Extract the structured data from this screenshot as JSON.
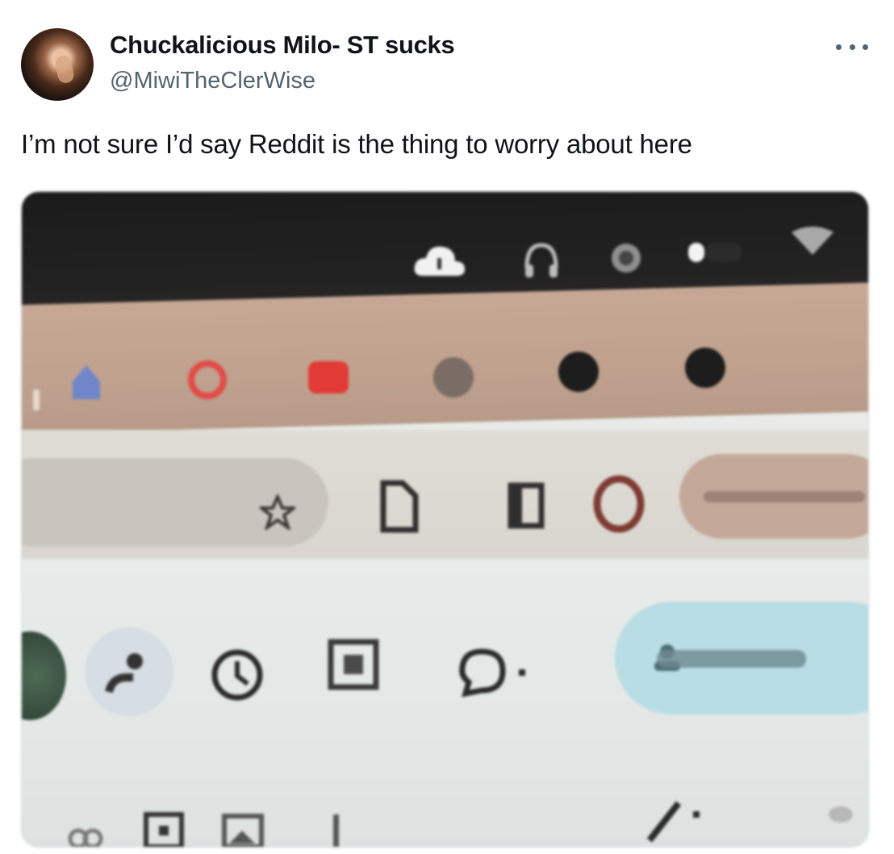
{
  "tweet": {
    "display_name": "Chuckalicious Milo- ST sucks",
    "handle": "@MiwiTheClerWise",
    "text": "I’m not sure I’d say Reddit is the thing to worry about here"
  },
  "media": {
    "icons": {
      "menubar": [
        "cloud-icon",
        "headphones-icon",
        "settings-icon",
        "battery-icon",
        "wifi-icon"
      ],
      "tabs": [
        "tab-favicon-blue",
        "tab-favicon-red-ring",
        "tab-favicon-red-square",
        "tab-favicon-gray",
        "tab-favicon-black",
        "tab-favicon-black"
      ],
      "toolbar": [
        "star-icon",
        "page-icon",
        "sidebar-icon",
        "profile-ring-icon"
      ],
      "app": [
        "avatar-icon",
        "people-icon",
        "history-icon",
        "image-icon",
        "comment-icon",
        "share-people-icon"
      ],
      "bottom": [
        "link-icon",
        "add-image-icon",
        "image-icon",
        "pen-icon"
      ]
    },
    "colors": {
      "menubar": "#1f1f1f",
      "tabs": "#c1a38f",
      "toolbar": "#dcd9d2",
      "app": "#e5eae8",
      "share": "#b9dde4"
    }
  }
}
